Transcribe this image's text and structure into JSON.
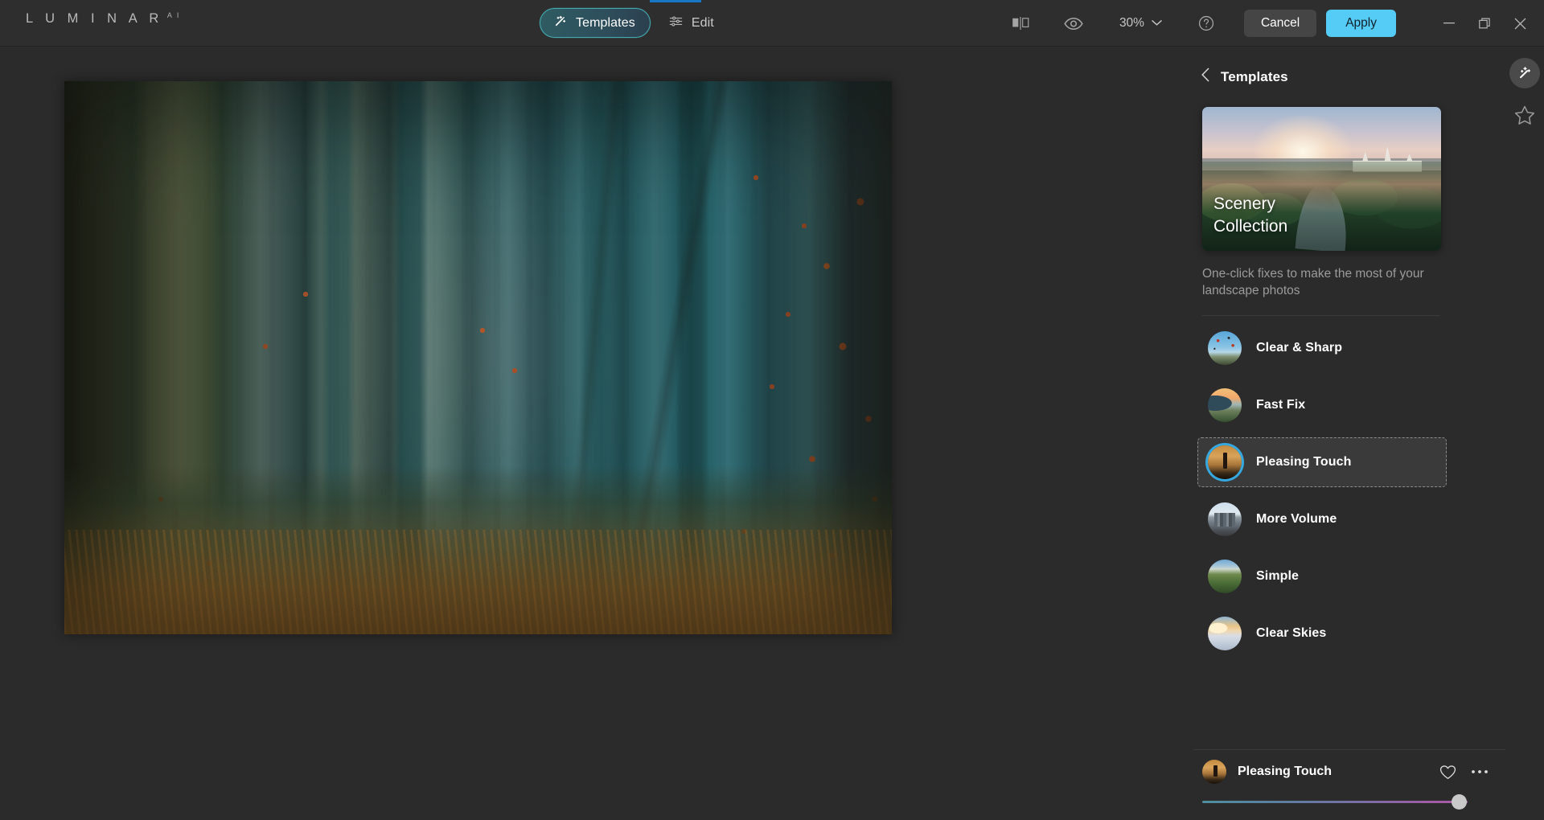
{
  "app": {
    "brand": "L U M I N A R",
    "brand_sup": "A I",
    "accent_cyan": "#55ccf5",
    "accent_teal": "#45a9b0",
    "panel_bg": "#2b2b2b",
    "topbar_bg": "#2e2e2e",
    "progress_color": "#1976c4"
  },
  "toolbar": {
    "modes": [
      {
        "label": "Templates",
        "icon": "magic-wand-icon",
        "active": true
      },
      {
        "label": "Edit",
        "icon": "sliders-icon",
        "active": false
      }
    ],
    "compare_icon": "compare-split-icon",
    "preview_icon": "eye-icon",
    "zoom_value": "30%",
    "zoom_chevron_icon": "chevron-down-icon",
    "help_icon": "help-circle-icon",
    "cancel_label": "Cancel",
    "apply_label": "Apply",
    "window_minimize_icon": "minimize-icon",
    "window_restore_icon": "restore-icon",
    "window_close_icon": "close-icon"
  },
  "panel": {
    "back_icon": "chevron-left-icon",
    "title": "Templates",
    "collection": {
      "title_line1": "Scenery",
      "title_line2": "Collection",
      "description": "One-click fixes to make the most of your landscape photos"
    },
    "templates": [
      {
        "label": "Clear & Sharp",
        "thumb": "th-balloons",
        "selected": false
      },
      {
        "label": "Fast Fix",
        "thumb": "th-fastfix",
        "selected": false
      },
      {
        "label": "Pleasing Touch",
        "thumb": "th-lighthouse",
        "selected": true
      },
      {
        "label": "More Volume",
        "thumb": "th-city",
        "selected": false
      },
      {
        "label": "Simple",
        "thumb": "th-simple",
        "selected": false
      },
      {
        "label": "Clear Skies",
        "thumb": "th-clearskies",
        "selected": false
      }
    ],
    "applied": {
      "name": "Pleasing Touch",
      "favorite_icon": "heart-icon",
      "more_icon": "more-horizontal-icon",
      "slider_value": 94,
      "slider_gradient_start": "#4f8f9e",
      "slider_gradient_end": "#a85ba6"
    }
  },
  "rail": {
    "wand_icon": "magic-wand-circle-icon",
    "star_icon": "star-outline-icon"
  },
  "canvas": {
    "image_alt": "misty autumn forest photo"
  }
}
